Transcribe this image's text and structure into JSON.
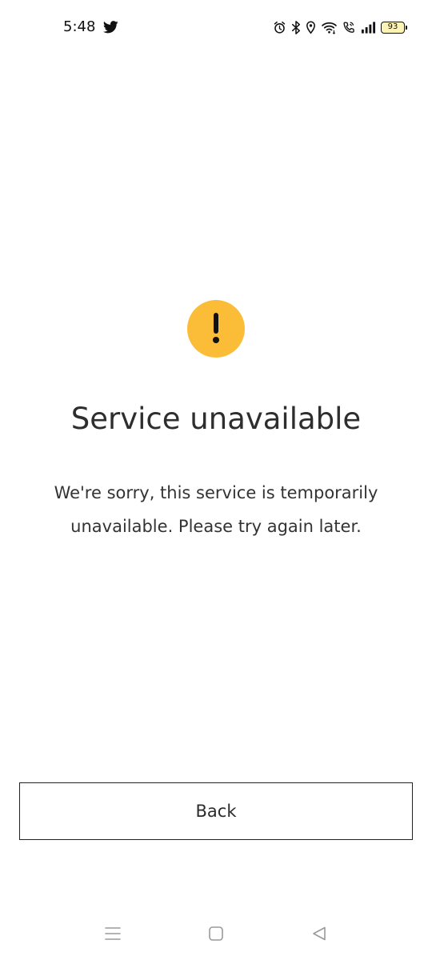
{
  "status_bar": {
    "time": "5:48",
    "battery_level": "93",
    "icons": [
      "twitter-icon",
      "alarm-icon",
      "bluetooth-icon",
      "location-icon",
      "wifi-icon",
      "wifi-call-icon",
      "signal-icon",
      "battery-icon"
    ]
  },
  "error": {
    "icon": "warning-icon",
    "title": "Service unavailable",
    "message": "We're sorry, this service is temporarily unavailable. Please try again later."
  },
  "actions": {
    "back_label": "Back"
  },
  "navigation": {
    "icons": [
      "menu-icon",
      "home-icon",
      "back-triangle-icon"
    ]
  },
  "colors": {
    "warning": "#fbbc38",
    "text": "#2e2e2e",
    "background": "#ffffff",
    "battery_fill": "#fdf3b6"
  }
}
